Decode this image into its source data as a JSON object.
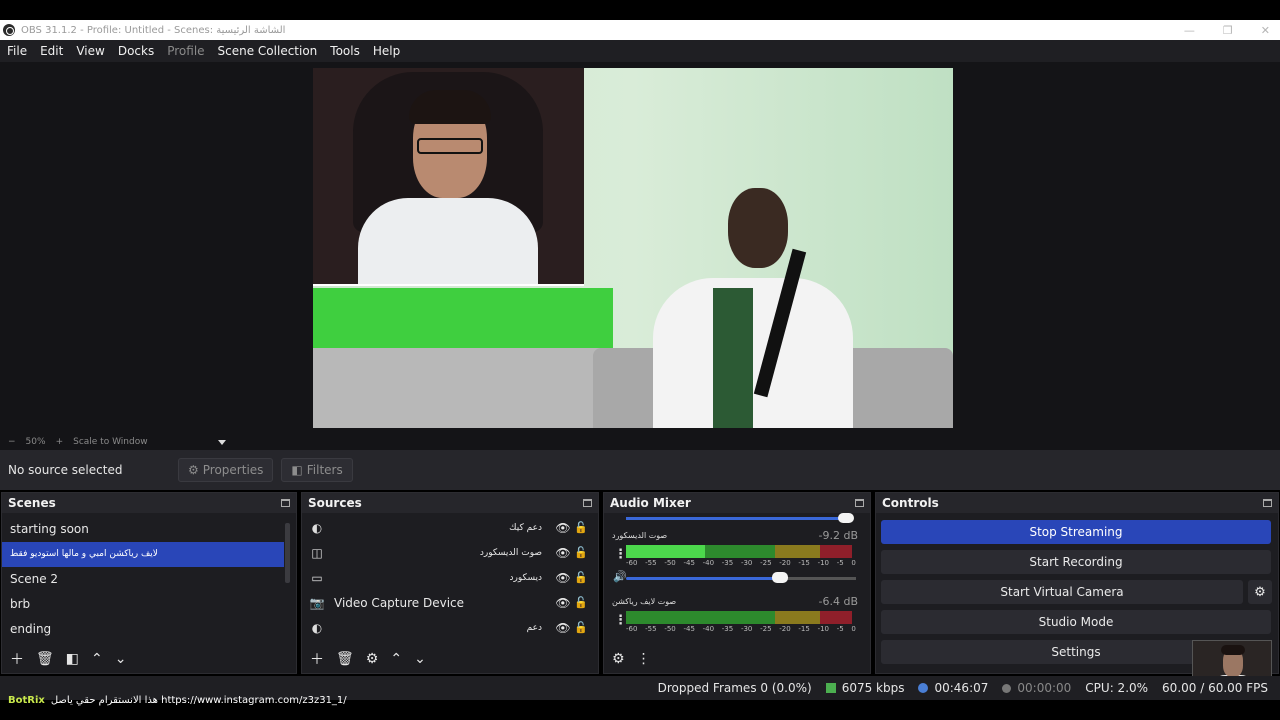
{
  "window": {
    "title": "OBS 31.1.2 - Profile: Untitled - Scenes: الشاشة الرئيسية",
    "controls": [
      "—",
      "❐",
      "✕"
    ]
  },
  "menu": [
    "File",
    "Edit",
    "View",
    "Docks",
    "Profile",
    "Scene Collection",
    "Tools",
    "Help"
  ],
  "zoom": {
    "minus": "−",
    "level": "50%",
    "plus": "+",
    "mode": "Scale to Window"
  },
  "source_bar": {
    "no_selection": "No source selected",
    "properties": "Properties",
    "filters": "Filters"
  },
  "scenes": {
    "title": "Scenes",
    "items": [
      "starting soon",
      "لايف رياكشن امبي و مالها استوديو فقط",
      "Scene 2",
      "brb",
      "ending"
    ],
    "active_index": 1
  },
  "sources": {
    "title": "Sources",
    "items": [
      {
        "label": "دعم كيك",
        "icon": "browser-icon",
        "rtl": true
      },
      {
        "label": "صوت الديسكورد",
        "icon": "audio-output-icon",
        "rtl": true
      },
      {
        "label": "ديسكورد",
        "icon": "window-capture-icon",
        "rtl": true
      },
      {
        "label": "Video Capture Device",
        "icon": "camera-icon",
        "rtl": false
      },
      {
        "label": "دعم",
        "icon": "browser-icon",
        "rtl": true
      }
    ]
  },
  "mixer": {
    "title": "Audio Mixer",
    "tracks": [
      {
        "name": "صوت الديسكورد",
        "db": "-9.2 dB"
      },
      {
        "name": "صوت لايف رياكشن",
        "db": "-6.4 dB"
      }
    ],
    "ticks": [
      "-60",
      "-55",
      "-50",
      "-45",
      "-40",
      "-35",
      "-30",
      "-25",
      "-20",
      "-15",
      "-10",
      "-5",
      "0"
    ]
  },
  "controls": {
    "title": "Controls",
    "stop_streaming": "Stop Streaming",
    "start_recording": "Start Recording",
    "start_virtual_camera": "Start Virtual Camera",
    "studio_mode": "Studio Mode",
    "settings": "Settings"
  },
  "status": {
    "dropped_frames": "Dropped Frames 0 (0.0%)",
    "bitrate": "6075 kbps",
    "stream_time": "00:46:07",
    "rec_time": "00:00:00",
    "cpu": "CPU: 2.0%",
    "fps": "60.00 / 60.00 FPS"
  },
  "chat": {
    "user": "BotRix",
    "message": "هذا الانستقرام حقي ياصل https://www.instagram.com/z3z31_1/"
  },
  "colors": {
    "accent": "#2946b8",
    "panel": "#1d1d21",
    "meter_green": "#4cd84c"
  }
}
